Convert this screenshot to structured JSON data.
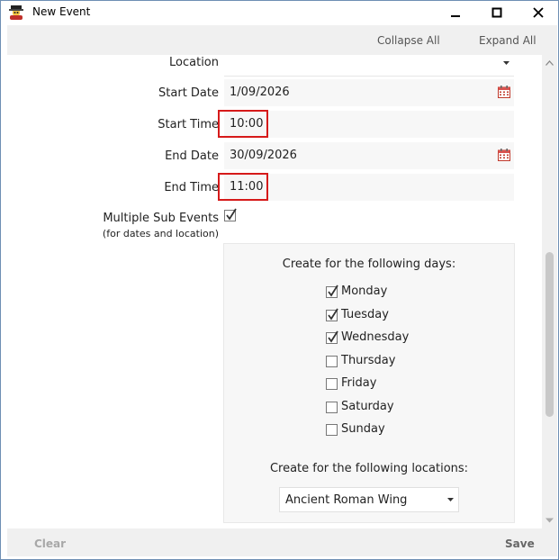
{
  "window": {
    "title": "New Event"
  },
  "toolbar": {
    "collapse_all": "Collapse All",
    "expand_all": "Expand All"
  },
  "form": {
    "location_label": "Location",
    "location_value": "",
    "start_date_label": "Start Date",
    "start_date_value": "1/09/2026",
    "start_time_label": "Start Time",
    "start_time_value": "10:00",
    "end_date_label": "End Date",
    "end_date_value": "30/09/2026",
    "end_time_label": "End Time",
    "end_time_value": "11:00",
    "multiple_label": "Multiple Sub Events",
    "multiple_sublabel": "(for dates and location)",
    "multiple_checked": true
  },
  "sub_events": {
    "days_header": "Create for the following days:",
    "days": [
      {
        "label": "Monday",
        "checked": true
      },
      {
        "label": "Tuesday",
        "checked": true
      },
      {
        "label": "Wednesday",
        "checked": true
      },
      {
        "label": "Thursday",
        "checked": false
      },
      {
        "label": "Friday",
        "checked": false
      },
      {
        "label": "Saturday",
        "checked": false
      },
      {
        "label": "Sunday",
        "checked": false
      }
    ],
    "locations_header": "Create for the following locations:",
    "location_selected": "Ancient Roman Wing"
  },
  "footer": {
    "clear_label": "Clear",
    "save_label": "Save"
  },
  "colors": {
    "highlight": "#d61a1a",
    "border": "#6e8fb4",
    "panel": "#f7f7f7"
  }
}
